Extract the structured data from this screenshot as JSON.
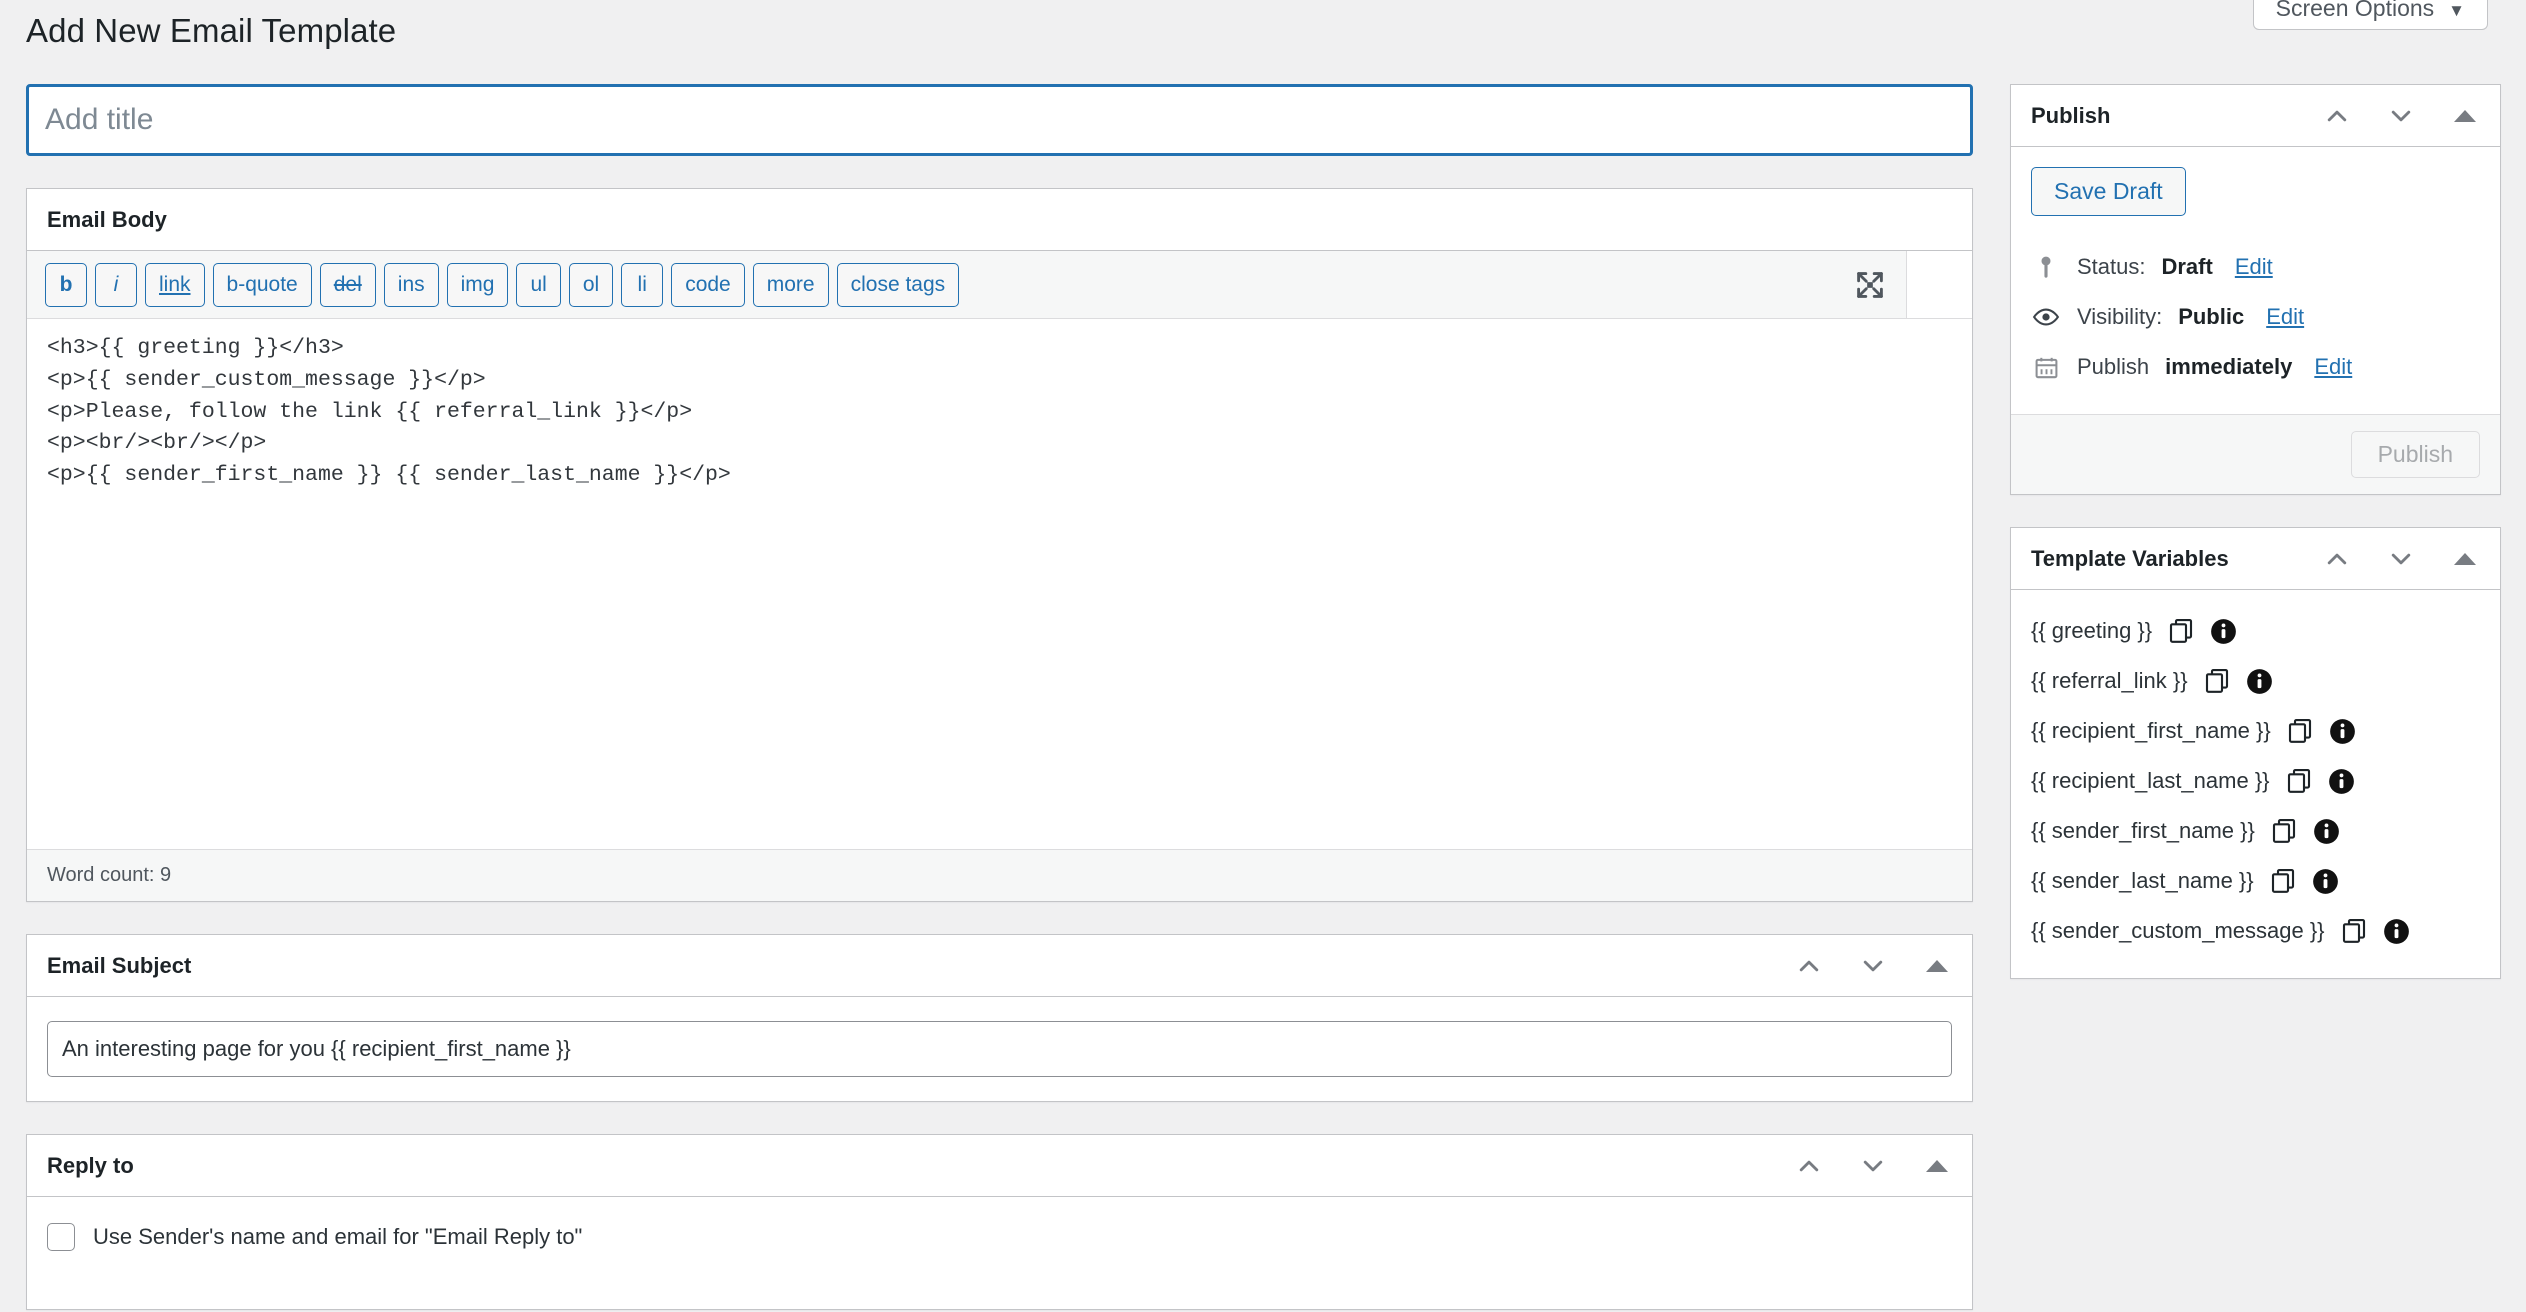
{
  "header": {
    "page_title": "Add New Email Template",
    "screen_options_label": "Screen Options",
    "screen_options_caret": "▼"
  },
  "title_field": {
    "value": "",
    "placeholder": "Add title"
  },
  "email_body": {
    "panel_title": "Email Body",
    "toolbar_buttons": [
      {
        "label": "b",
        "style": "bold-b"
      },
      {
        "label": "i",
        "style": "italic"
      },
      {
        "label": "link",
        "style": "underline"
      },
      {
        "label": "b-quote",
        "style": ""
      },
      {
        "label": "del",
        "style": "strike"
      },
      {
        "label": "ins",
        "style": ""
      },
      {
        "label": "img",
        "style": ""
      },
      {
        "label": "ul",
        "style": ""
      },
      {
        "label": "ol",
        "style": ""
      },
      {
        "label": "li",
        "style": ""
      },
      {
        "label": "code",
        "style": ""
      },
      {
        "label": "more",
        "style": ""
      },
      {
        "label": "close tags",
        "style": ""
      }
    ],
    "content": "<h3>{{ greeting }}</h3>\n<p>{{ sender_custom_message }}</p>\n<p>Please, follow the link {{ referral_link }}</p>\n<p><br/><br/></p>\n<p>{{ sender_first_name }} {{ sender_last_name }}</p>",
    "word_count": "Word count: 9",
    "fullscreen_icon": "fullscreen-icon"
  },
  "email_subject": {
    "panel_title": "Email Subject",
    "value": "An interesting page for you {{ recipient_first_name }}",
    "placeholder": ""
  },
  "reply_to": {
    "panel_title": "Reply to",
    "checkbox_label": "Use Sender's name and email for \"Email Reply to\"",
    "checked": false
  },
  "publish": {
    "panel_title": "Publish",
    "save_draft_label": "Save Draft",
    "status_prefix": "Status:",
    "status_value": "Draft",
    "status_edit": "Edit",
    "visibility_prefix": "Visibility:",
    "visibility_value": "Public",
    "visibility_edit": "Edit",
    "schedule_prefix": "Publish",
    "schedule_value": "immediately",
    "schedule_edit": "Edit",
    "publish_label": "Publish",
    "publish_disabled": true
  },
  "template_variables": {
    "panel_title": "Template Variables",
    "items": [
      {
        "name": "{{ greeting }}"
      },
      {
        "name": "{{ referral_link }}"
      },
      {
        "name": "{{ recipient_first_name }}"
      },
      {
        "name": "{{ recipient_last_name }}"
      },
      {
        "name": "{{ sender_first_name }}"
      },
      {
        "name": "{{ sender_last_name }}"
      },
      {
        "name": "{{ sender_custom_message }}"
      }
    ]
  },
  "colors": {
    "accent": "#2271b1",
    "page_bg": "#f0f0f1",
    "border": "#c3c4c7",
    "text": "#1d2327"
  }
}
